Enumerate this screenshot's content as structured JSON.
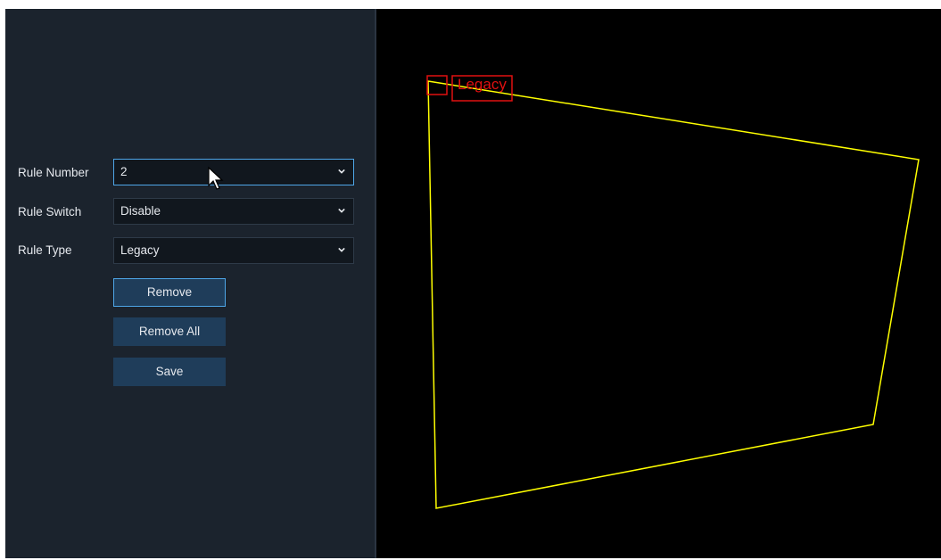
{
  "form": {
    "rule_number": {
      "label": "Rule Number",
      "value": "2"
    },
    "rule_switch": {
      "label": "Rule Switch",
      "value": "Disable"
    },
    "rule_type": {
      "label": "Rule Type",
      "value": "Legacy"
    }
  },
  "buttons": {
    "remove": "Remove",
    "remove_all": "Remove All",
    "save": "Save"
  },
  "overlay": {
    "rule_label": "Legacy",
    "line_color": "#ffff00",
    "label_color": "#e01010"
  },
  "icons": {
    "dropdown": "chevron-down-icon",
    "pointer": "mouse-cursor-icon"
  }
}
